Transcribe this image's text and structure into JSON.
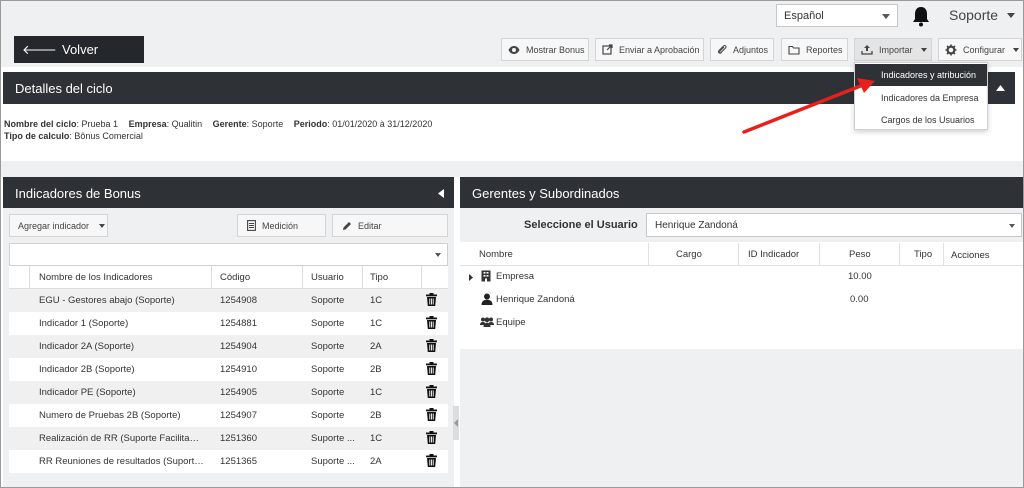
{
  "header": {
    "language": "Español",
    "user": "Soporte",
    "back_label": "Volver",
    "icons": {
      "notifications": "bell-icon",
      "back": "arrow-left-icon"
    }
  },
  "toolbar": {
    "buttons": [
      {
        "label": "Mostrar Bonus",
        "icon": "eye-icon"
      },
      {
        "label": "Enviar a Aprobación",
        "icon": "external-link-icon"
      },
      {
        "label": "Adjuntos",
        "icon": "paperclip-icon"
      },
      {
        "label": "Reportes",
        "icon": "folder-icon"
      },
      {
        "label": "Importar",
        "icon": "upload-icon"
      },
      {
        "label": "Configurar",
        "icon": "gear-icon"
      }
    ]
  },
  "import_menu": {
    "items": [
      "Indicadores y atribución",
      "Indicadores da Empresa",
      "Cargos de los Usuarios"
    ],
    "highlighted_index": 0
  },
  "cycle_details": {
    "title": "Detalles del ciclo",
    "fields": [
      {
        "label": "Nombre del ciclo",
        "value": ": Prueba 1"
      },
      {
        "label": "Empresa",
        "value": ": Qualitin"
      },
      {
        "label": "Gerente",
        "value": ": Soporte"
      },
      {
        "label": "Periodo",
        "value": ": 01/01/2020 à 31/12/2020"
      }
    ],
    "calc_type": {
      "label": "Tipo de calculo",
      "value": ": Bônus Comercial"
    }
  },
  "bonus_panel": {
    "title": "Indicadores de Bonus",
    "add_indicator_label": "Agregar indicador",
    "measurement_label": "Medición",
    "edit_label": "Editar",
    "columns": [
      "Nombre de los Indicadores",
      "Código",
      "Usuario",
      "Tipo"
    ],
    "rows": [
      {
        "name": "EGU - Gestores abajo (Soporte)",
        "code": "1254908",
        "user": "Soporte",
        "type": "1C"
      },
      {
        "name": "Indicador 1 (Soporte)",
        "code": "1254881",
        "user": "Soporte",
        "type": "1C"
      },
      {
        "name": "Indicador 2A (Soporte)",
        "code": "1254904",
        "user": "Soporte",
        "type": "2A"
      },
      {
        "name": "Indicador 2B (Soporte)",
        "code": "1254910",
        "user": "Soporte",
        "type": "2B"
      },
      {
        "name": "Indicador PE (Soporte)",
        "code": "1254905",
        "user": "Soporte",
        "type": "1C"
      },
      {
        "name": "Numero de Pruebas 2B (Soporte)",
        "code": "1254907",
        "user": "Soporte",
        "type": "2B"
      },
      {
        "name": "Realización de RR (Suporte Facilitador)",
        "code": "1251360",
        "user": "Suporte ...",
        "type": "1C"
      },
      {
        "name": "RR Reuniones de resultados (Suporte Facilitador)",
        "code": "1251365",
        "user": "Suporte ...",
        "type": "2A"
      }
    ]
  },
  "managers_panel": {
    "title": "Gerentes y Subordinados",
    "select_label": "Seleccione el Usuario",
    "selected_user": "Henrique Zandoná",
    "columns": [
      "Nombre",
      "Cargo",
      "ID Indicador",
      "Peso",
      "Tipo",
      "Acciones"
    ],
    "tree": [
      {
        "name": "Empresa",
        "peso": "10.00",
        "icon": "building-icon"
      },
      {
        "name": "Henrique Zandoná",
        "peso": "0.00",
        "icon": "user-icon"
      },
      {
        "name": "Equipe",
        "peso": "",
        "icon": "users-icon"
      }
    ]
  },
  "colors": {
    "header_dark": "#2e3236",
    "button_dark": "#24272b",
    "annotation_arrow": "#e8201c",
    "panel_bg": "#eef0f1"
  }
}
